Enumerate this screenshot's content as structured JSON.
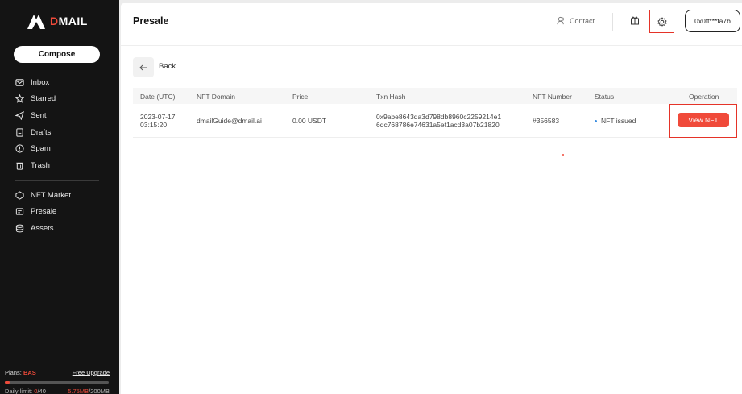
{
  "brand": {
    "name_prefix": "D",
    "name_rest": "MAIL"
  },
  "sidebar": {
    "compose_label": "Compose",
    "items": [
      {
        "label": "Inbox",
        "icon": "inbox-icon"
      },
      {
        "label": "Starred",
        "icon": "star-icon"
      },
      {
        "label": "Sent",
        "icon": "send-icon"
      },
      {
        "label": "Drafts",
        "icon": "draft-icon"
      },
      {
        "label": "Spam",
        "icon": "spam-icon"
      },
      {
        "label": "Trash",
        "icon": "trash-icon"
      }
    ],
    "items2": [
      {
        "label": "NFT Market",
        "icon": "nft-market-icon"
      },
      {
        "label": "Presale",
        "icon": "presale-icon"
      },
      {
        "label": "Assets",
        "icon": "assets-icon"
      }
    ],
    "plan_label": "Plans: ",
    "plan_value": "BAS",
    "upgrade_label": "Free Upgrade",
    "daily_label": "Daily limit: ",
    "daily_used": "0",
    "daily_total": "/40",
    "storage_used": "5.75MB",
    "storage_total": "/200MB",
    "daily_progress": 0.05
  },
  "header": {
    "title": "Presale",
    "contact_label": "Contact",
    "wallet": "0x0ff***fa7b"
  },
  "back_label": "Back",
  "table": {
    "columns": [
      "Date (UTC)",
      "NFT Domain",
      "Price",
      "Txn Hash",
      "NFT Number",
      "Status",
      "Operation"
    ],
    "row": {
      "date": "2023-07-17",
      "time": "03:15:20",
      "domain": "dmailGuide@dmail.ai",
      "price": "0.00 USDT",
      "hash_line1": "0x9abe8643da3d798db8960c2259214e1",
      "hash_line2": "6dc768786e74631a5ef1acd3a07b21820",
      "nft_number": "#356583",
      "status": "NFT issued",
      "action": "View NFT"
    }
  },
  "colors": {
    "accent": "#f04a3a",
    "sidebar_bg": "#141414"
  }
}
